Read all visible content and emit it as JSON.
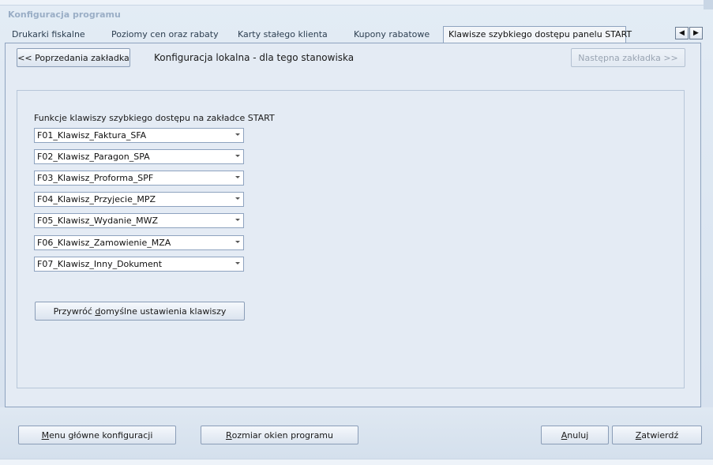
{
  "window": {
    "title": "Konfiguracja programu"
  },
  "tabs": [
    {
      "label": "Drukarki fiskalne"
    },
    {
      "label": "Poziomy cen oraz rabaty"
    },
    {
      "label": "Karty stałego klienta"
    },
    {
      "label": "Kupony rabatowe"
    },
    {
      "label": "Klawisze szybkiego dostępu  panelu START",
      "active": true
    }
  ],
  "tab_nav": {
    "left": "◀",
    "right": "▶"
  },
  "header": {
    "prev_button": "<< Poprzedania zakładka",
    "title": "Konfiguracja lokalna - dla tego stanowiska",
    "next_button": "Następna zakładka >>"
  },
  "hotkeys": {
    "label": "Funkcje klawiszy szybkiego dostępu na zakładce START",
    "items": [
      "F01_Klawisz_Faktura_SFA",
      "F02_Klawisz_Paragon_SPA",
      "F03_Klawisz_Proforma_SPF",
      "F04_Klawisz_Przyjecie_MPZ",
      "F05_Klawisz_Wydanie_MWZ",
      "F06_Klawisz_Zamowienie_MZA",
      "F07_Klawisz_Inny_Dokument"
    ],
    "restore_pre": "Przywróć ",
    "restore_key": "d",
    "restore_post": "omyślne ustawienia klawiszy"
  },
  "footer": {
    "main_menu_key": "M",
    "main_menu_rest": "enu główne konfiguracji",
    "window_size_key": "R",
    "window_size_rest": "ozmiar okien programu",
    "cancel_key": "A",
    "cancel_rest": "nuluj",
    "confirm_key": "Z",
    "confirm_rest": "atwierdź"
  },
  "colors": {
    "accent": "#8ea3bf",
    "background": "#e4ebf4",
    "title": "#9aaec6"
  }
}
